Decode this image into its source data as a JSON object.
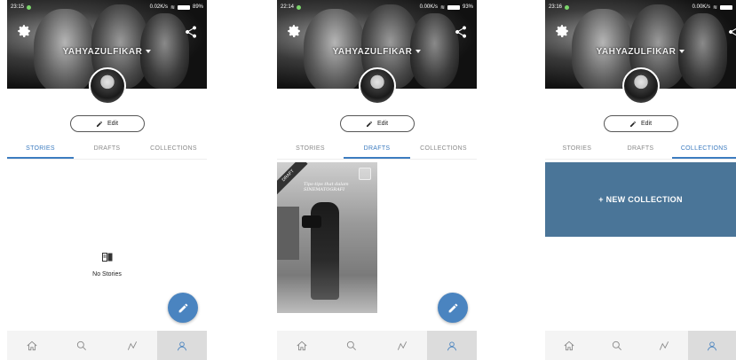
{
  "screens": [
    {
      "status": {
        "time": "23:15",
        "speed": "0.02K/s",
        "battery": "89%"
      },
      "username": "YAHYAZULFIKAR",
      "edit_label": "Edit",
      "tabs": [
        {
          "label": "STORIES",
          "active": true
        },
        {
          "label": "DRAFTS",
          "active": false
        },
        {
          "label": "COLLECTIONS",
          "active": false
        }
      ],
      "empty_label": "No Stories",
      "nav_active": "profile"
    },
    {
      "status": {
        "time": "22:14",
        "speed": "0.00K/s",
        "battery": "93%"
      },
      "username": "YAHYAZULFIKAR",
      "edit_label": "Edit",
      "tabs": [
        {
          "label": "STORIES",
          "active": false
        },
        {
          "label": "DRAFTS",
          "active": true
        },
        {
          "label": "COLLECTIONS",
          "active": false
        }
      ],
      "draft": {
        "tag": "DRAFT",
        "caption_line1": "Tips-tips that dalam",
        "caption_line2": "SINEMATOGRAFI"
      },
      "nav_active": "profile"
    },
    {
      "status": {
        "time": "23:16",
        "speed": "0.00K/s"
      },
      "username": "YAHYAZULFIKAR",
      "edit_label": "Edit",
      "tabs": [
        {
          "label": "STORIES",
          "active": false
        },
        {
          "label": "DRAFTS",
          "active": false
        },
        {
          "label": "COLLECTIONS",
          "active": true
        }
      ],
      "new_collection_label": "+ NEW COLLECTION",
      "nav_active": "profile"
    }
  ],
  "nav": [
    "home-icon",
    "search-icon",
    "trending-icon",
    "profile-icon"
  ],
  "colors": {
    "accent": "#3d7cc0",
    "fab": "#4a84c0",
    "collection_banner": "#4a7598"
  }
}
